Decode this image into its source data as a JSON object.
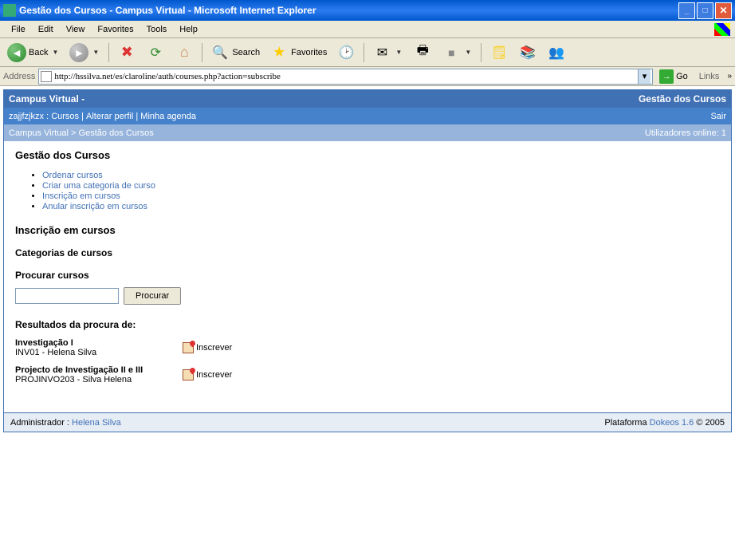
{
  "window": {
    "title": "Gestão dos Cursos - Campus Virtual - Microsoft Internet Explorer"
  },
  "menubar": {
    "items": [
      "File",
      "Edit",
      "View",
      "Favorites",
      "Tools",
      "Help"
    ]
  },
  "toolbar": {
    "back_label": "Back",
    "search_label": "Search",
    "favorites_label": "Favorites"
  },
  "addressbar": {
    "label": "Address",
    "url": "http://hssilva.net/es/claroline/auth/courses.php?action=subscribe",
    "go_label": "Go",
    "links_label": "Links"
  },
  "siteheader": {
    "left": "Campus Virtual -",
    "right": "Gestão dos Cursos"
  },
  "navbar": {
    "user": "zajjfzjkzx :",
    "links": [
      "Cursos",
      "Alterar perfil",
      "Minha agenda"
    ],
    "logout": "Sair"
  },
  "breadcrumb": {
    "root": "Campus Virtual",
    "current": "Gestão dos Cursos",
    "users_online_label": "Utilizadores online:",
    "users_online_count": "1"
  },
  "content": {
    "page_title": "Gestão dos Cursos",
    "actions": [
      "Ordenar cursos",
      "Criar uma categoria de curso",
      "Inscrição em cursos",
      "Anular inscrição em cursos"
    ],
    "section_title": "Inscrição em cursos",
    "categories_heading": "Categorias de cursos",
    "search_heading": "Procurar cursos",
    "search_button": "Procurar",
    "search_value": "",
    "results_heading": "Resultados da procura de:",
    "enroll_label": "Inscrever",
    "results": [
      {
        "title": "Investigação I",
        "subtitle": "INV01 - Helena Silva"
      },
      {
        "title": "Projecto de Investigação II e III",
        "subtitle": "PROJINVO203 - Silva Helena"
      }
    ]
  },
  "footer": {
    "admin_label": "Administrador :",
    "admin_name": "Helena Silva",
    "platform_label": "Plataforma",
    "platform_name": "Dokeos 1.6",
    "copyright": "© 2005"
  }
}
